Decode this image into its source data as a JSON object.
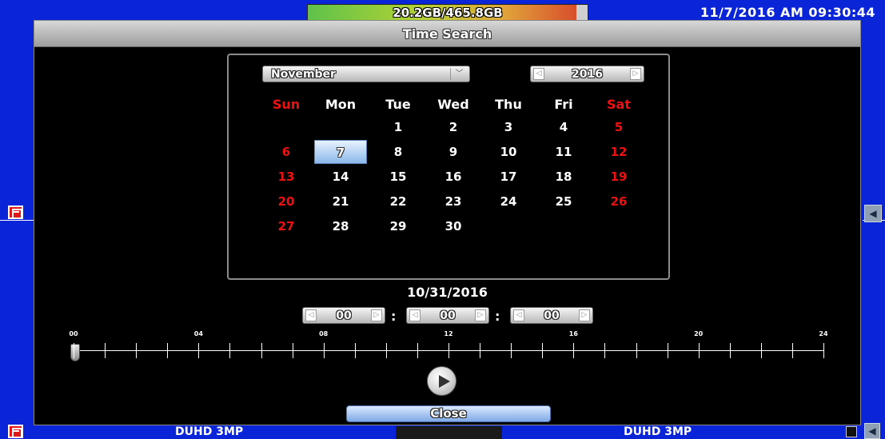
{
  "topbar": {
    "storage": "20.2GB/465.8GB",
    "clock": "11/7/2016 AM 09:30:44"
  },
  "dialog": {
    "title": "Time Search",
    "month": "November",
    "year": "2016",
    "weekdays": [
      "Sun",
      "Mon",
      "Tue",
      "Wed",
      "Thu",
      "Fri",
      "Sat"
    ],
    "days": [
      [
        "",
        "",
        "1",
        "2",
        "3",
        "4",
        "5"
      ],
      [
        "6",
        "7",
        "8",
        "9",
        "10",
        "11",
        "12"
      ],
      [
        "13",
        "14",
        "15",
        "16",
        "17",
        "18",
        "19"
      ],
      [
        "20",
        "21",
        "22",
        "23",
        "24",
        "25",
        "26"
      ],
      [
        "27",
        "28",
        "29",
        "30",
        "",
        "",
        ""
      ]
    ],
    "selected_day": "7",
    "selected_date": "10/31/2016",
    "time": {
      "hour": "00",
      "minute": "00",
      "second": "00",
      "separator": ":"
    },
    "timeline_labels": [
      "00",
      "04",
      "08",
      "12",
      "16",
      "20",
      "24"
    ],
    "close_label": "Close"
  },
  "bottom": {
    "cam_left": "DUHD 3MP",
    "cam_right": "DUHD 3MP"
  },
  "colors": {
    "background": "#0a24d8",
    "weekend": "#ee1111",
    "selected": "#8ab8ea"
  },
  "icons": {
    "left": "film-icon",
    "right": "speaker-icon",
    "play": "play-icon",
    "corner": "square-icon"
  }
}
